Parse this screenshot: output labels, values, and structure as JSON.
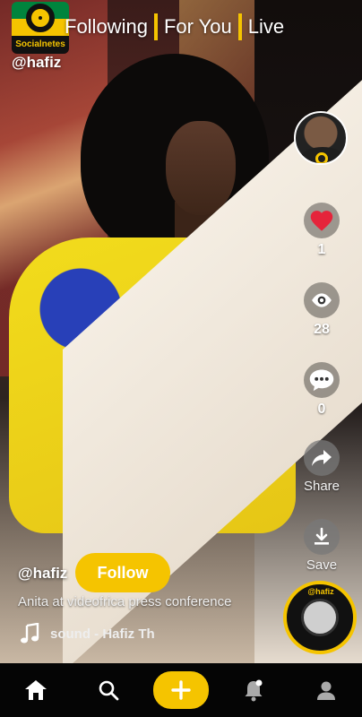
{
  "header": {
    "logo_text": "Socialnetes",
    "tabs": [
      {
        "label": "Following"
      },
      {
        "label": "For You"
      },
      {
        "label": "Live"
      }
    ],
    "username": "@hafiz"
  },
  "rail": {
    "likes": {
      "count": "1",
      "icon": "heart-icon"
    },
    "views": {
      "count": "28",
      "icon": "eye-icon"
    },
    "comments": {
      "count": "0",
      "icon": "comment-icon"
    },
    "share": {
      "label": "Share",
      "icon": "share-icon"
    },
    "save": {
      "label": "Save",
      "icon": "download-icon"
    }
  },
  "post": {
    "author": "@hafiz",
    "follow_label": "Follow",
    "caption": "Anita at videofrica press conference",
    "sound": "sound - Hafiz Th",
    "disc_label": "@hafiz"
  },
  "colors": {
    "accent": "#f5c400",
    "like": "#e5243b"
  },
  "bottom_nav": [
    "home-icon",
    "search-icon",
    "plus-icon",
    "notifications-icon",
    "profile-icon"
  ]
}
